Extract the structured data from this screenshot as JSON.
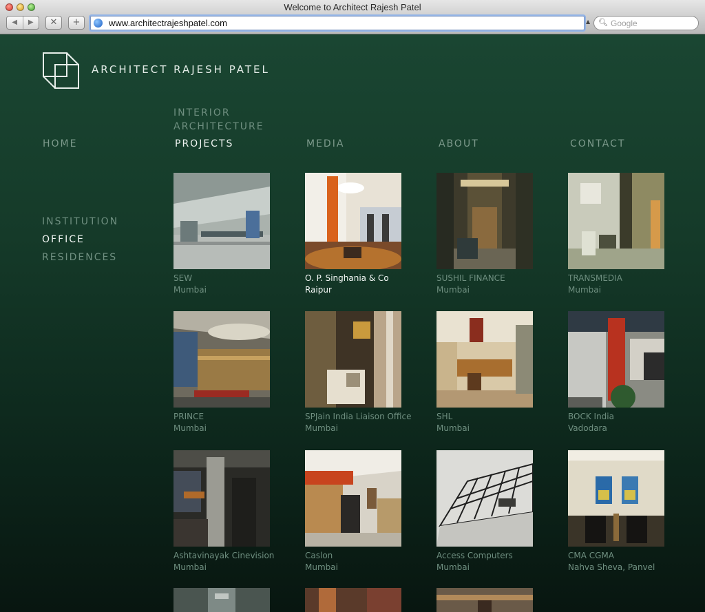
{
  "browser": {
    "window_title": "Welcome to Architect Rajesh Patel",
    "url": "www.architectrajeshpatel.com",
    "search_placeholder": "Google"
  },
  "site": {
    "brand": "ARCHITECT RAJESH PATEL",
    "subnav": [
      "INTERIOR",
      "ARCHITECTURE"
    ],
    "nav": [
      "HOME",
      "PROJECTS",
      "MEDIA",
      "ABOUT",
      "CONTACT"
    ],
    "nav_active": "PROJECTS",
    "categories": [
      "INSTITUTION",
      "OFFICE",
      "RESIDENCES"
    ],
    "category_active": "OFFICE"
  },
  "projects": [
    {
      "name": "SEW",
      "city": "Mumbai"
    },
    {
      "name": "O. P. Singhania & Co",
      "city": "Raipur",
      "active": true
    },
    {
      "name": "SUSHIL FINANCE",
      "city": "Mumbai"
    },
    {
      "name": "TRANSMEDIA",
      "city": "Mumbai"
    },
    {
      "name": "PRINCE",
      "city": "Mumbai"
    },
    {
      "name": "SPJain India Liaison Office",
      "city": "Mumbai"
    },
    {
      "name": "SHL",
      "city": "Mumbai"
    },
    {
      "name": "BOCK India",
      "city": "Vadodara"
    },
    {
      "name": "Ashtavinayak Cinevision",
      "city": "Mumbai"
    },
    {
      "name": "Caslon",
      "city": "Mumbai"
    },
    {
      "name": "Access Computers",
      "city": "Mumbai"
    },
    {
      "name": "CMA CGMA",
      "city": "Nahva Sheva, Panvel"
    }
  ],
  "colors": {
    "page_bg_top": "#1a4632",
    "page_bg_bottom": "#081610",
    "text_muted": "#6f8f80",
    "text_active": "#f0f5f2"
  }
}
